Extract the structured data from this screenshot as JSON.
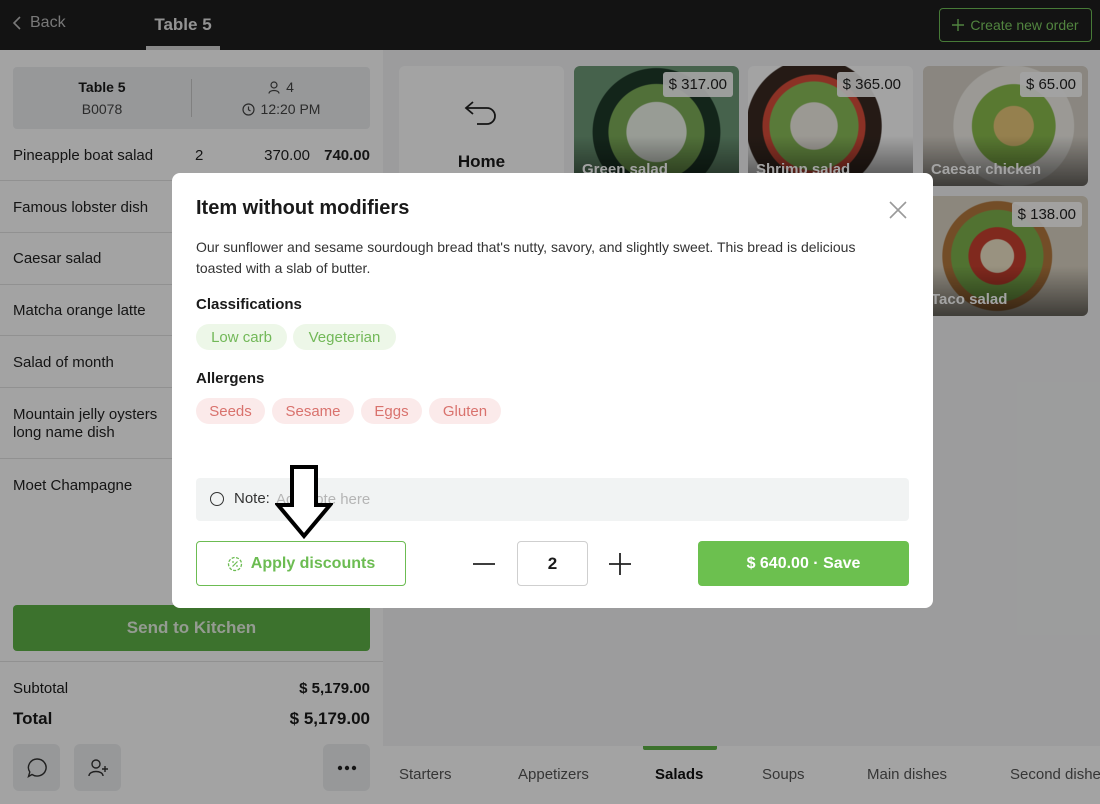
{
  "topbar": {
    "back_label": "Back",
    "table_tab": "Table 5",
    "create_order_label": "Create new order",
    "accent": "#6fbf56"
  },
  "order": {
    "table_name": "Table 5",
    "order_code": "B0078",
    "guests": "4",
    "time": "12:20 PM",
    "items": [
      {
        "name": "Pineapple boat salad",
        "qty": "2",
        "price": "370.00",
        "total": "740.00"
      },
      {
        "name": "Famous lobster dish"
      },
      {
        "name": "Caesar salad"
      },
      {
        "name": "Matcha orange latte"
      },
      {
        "name": "Salad of month"
      },
      {
        "name": "Mountain jelly oysters long name dish"
      },
      {
        "name": "Moet Champagne"
      }
    ],
    "send_label": "Send to Kitchen",
    "subtotal_label": "Subtotal",
    "subtotal_value": "$ 5,179.00",
    "total_label": "Total",
    "total_value": "$ 5,179.00"
  },
  "menu": {
    "home_label": "Home",
    "tiles": [
      {
        "name": "Green salad",
        "price": "$ 317.00"
      },
      {
        "name": "Shrimp salad",
        "price": "$ 365.00"
      },
      {
        "name": "Caesar chicken",
        "price": "$ 65.00"
      },
      {
        "name": "Taco salad",
        "price": "$ 138.00"
      }
    ],
    "categories": [
      "Starters",
      "Appetizers",
      "Salads",
      "Soups",
      "Main dishes",
      "Second dishes"
    ],
    "active_category": "Salads"
  },
  "modal": {
    "title": "Item without modifiers",
    "description": "Our sunflower and sesame sourdough bread that's nutty, savory, and slightly sweet. This bread is delicious toasted with a slab of butter.",
    "classifications_label": "Classifications",
    "classifications": [
      "Low carb",
      "Vegeterian"
    ],
    "allergens_label": "Allergens",
    "allergens": [
      "Seeds",
      "Sesame",
      "Eggs",
      "Gluten"
    ],
    "note_label": "Note:",
    "note_placeholder": "Add note here",
    "discount_label": "Apply discounts",
    "quantity": "2",
    "save_label": "$ 640.00 · Save"
  }
}
